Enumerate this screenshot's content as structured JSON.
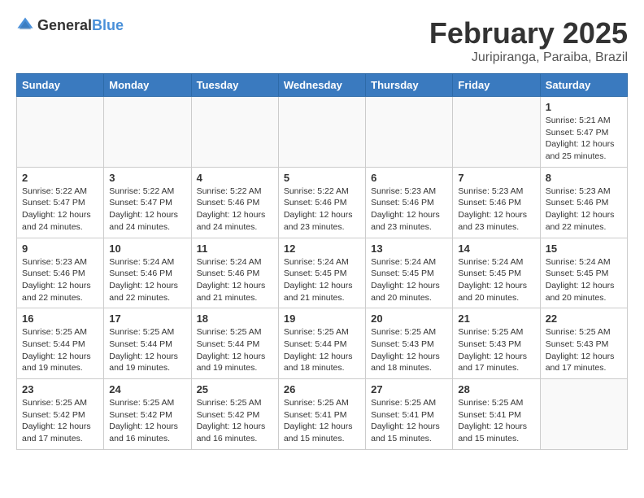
{
  "logo": {
    "text_general": "General",
    "text_blue": "Blue"
  },
  "header": {
    "month": "February 2025",
    "location": "Juripiranga, Paraiba, Brazil"
  },
  "days_of_week": [
    "Sunday",
    "Monday",
    "Tuesday",
    "Wednesday",
    "Thursday",
    "Friday",
    "Saturday"
  ],
  "weeks": [
    [
      {
        "day": "",
        "detail": ""
      },
      {
        "day": "",
        "detail": ""
      },
      {
        "day": "",
        "detail": ""
      },
      {
        "day": "",
        "detail": ""
      },
      {
        "day": "",
        "detail": ""
      },
      {
        "day": "",
        "detail": ""
      },
      {
        "day": "1",
        "detail": "Sunrise: 5:21 AM\nSunset: 5:47 PM\nDaylight: 12 hours\nand 25 minutes."
      }
    ],
    [
      {
        "day": "2",
        "detail": "Sunrise: 5:22 AM\nSunset: 5:47 PM\nDaylight: 12 hours\nand 24 minutes."
      },
      {
        "day": "3",
        "detail": "Sunrise: 5:22 AM\nSunset: 5:47 PM\nDaylight: 12 hours\nand 24 minutes."
      },
      {
        "day": "4",
        "detail": "Sunrise: 5:22 AM\nSunset: 5:46 PM\nDaylight: 12 hours\nand 24 minutes."
      },
      {
        "day": "5",
        "detail": "Sunrise: 5:22 AM\nSunset: 5:46 PM\nDaylight: 12 hours\nand 23 minutes."
      },
      {
        "day": "6",
        "detail": "Sunrise: 5:23 AM\nSunset: 5:46 PM\nDaylight: 12 hours\nand 23 minutes."
      },
      {
        "day": "7",
        "detail": "Sunrise: 5:23 AM\nSunset: 5:46 PM\nDaylight: 12 hours\nand 23 minutes."
      },
      {
        "day": "8",
        "detail": "Sunrise: 5:23 AM\nSunset: 5:46 PM\nDaylight: 12 hours\nand 22 minutes."
      }
    ],
    [
      {
        "day": "9",
        "detail": "Sunrise: 5:23 AM\nSunset: 5:46 PM\nDaylight: 12 hours\nand 22 minutes."
      },
      {
        "day": "10",
        "detail": "Sunrise: 5:24 AM\nSunset: 5:46 PM\nDaylight: 12 hours\nand 22 minutes."
      },
      {
        "day": "11",
        "detail": "Sunrise: 5:24 AM\nSunset: 5:46 PM\nDaylight: 12 hours\nand 21 minutes."
      },
      {
        "day": "12",
        "detail": "Sunrise: 5:24 AM\nSunset: 5:45 PM\nDaylight: 12 hours\nand 21 minutes."
      },
      {
        "day": "13",
        "detail": "Sunrise: 5:24 AM\nSunset: 5:45 PM\nDaylight: 12 hours\nand 20 minutes."
      },
      {
        "day": "14",
        "detail": "Sunrise: 5:24 AM\nSunset: 5:45 PM\nDaylight: 12 hours\nand 20 minutes."
      },
      {
        "day": "15",
        "detail": "Sunrise: 5:24 AM\nSunset: 5:45 PM\nDaylight: 12 hours\nand 20 minutes."
      }
    ],
    [
      {
        "day": "16",
        "detail": "Sunrise: 5:25 AM\nSunset: 5:44 PM\nDaylight: 12 hours\nand 19 minutes."
      },
      {
        "day": "17",
        "detail": "Sunrise: 5:25 AM\nSunset: 5:44 PM\nDaylight: 12 hours\nand 19 minutes."
      },
      {
        "day": "18",
        "detail": "Sunrise: 5:25 AM\nSunset: 5:44 PM\nDaylight: 12 hours\nand 19 minutes."
      },
      {
        "day": "19",
        "detail": "Sunrise: 5:25 AM\nSunset: 5:44 PM\nDaylight: 12 hours\nand 18 minutes."
      },
      {
        "day": "20",
        "detail": "Sunrise: 5:25 AM\nSunset: 5:43 PM\nDaylight: 12 hours\nand 18 minutes."
      },
      {
        "day": "21",
        "detail": "Sunrise: 5:25 AM\nSunset: 5:43 PM\nDaylight: 12 hours\nand 17 minutes."
      },
      {
        "day": "22",
        "detail": "Sunrise: 5:25 AM\nSunset: 5:43 PM\nDaylight: 12 hours\nand 17 minutes."
      }
    ],
    [
      {
        "day": "23",
        "detail": "Sunrise: 5:25 AM\nSunset: 5:42 PM\nDaylight: 12 hours\nand 17 minutes."
      },
      {
        "day": "24",
        "detail": "Sunrise: 5:25 AM\nSunset: 5:42 PM\nDaylight: 12 hours\nand 16 minutes."
      },
      {
        "day": "25",
        "detail": "Sunrise: 5:25 AM\nSunset: 5:42 PM\nDaylight: 12 hours\nand 16 minutes."
      },
      {
        "day": "26",
        "detail": "Sunrise: 5:25 AM\nSunset: 5:41 PM\nDaylight: 12 hours\nand 15 minutes."
      },
      {
        "day": "27",
        "detail": "Sunrise: 5:25 AM\nSunset: 5:41 PM\nDaylight: 12 hours\nand 15 minutes."
      },
      {
        "day": "28",
        "detail": "Sunrise: 5:25 AM\nSunset: 5:41 PM\nDaylight: 12 hours\nand 15 minutes."
      },
      {
        "day": "",
        "detail": ""
      }
    ]
  ]
}
